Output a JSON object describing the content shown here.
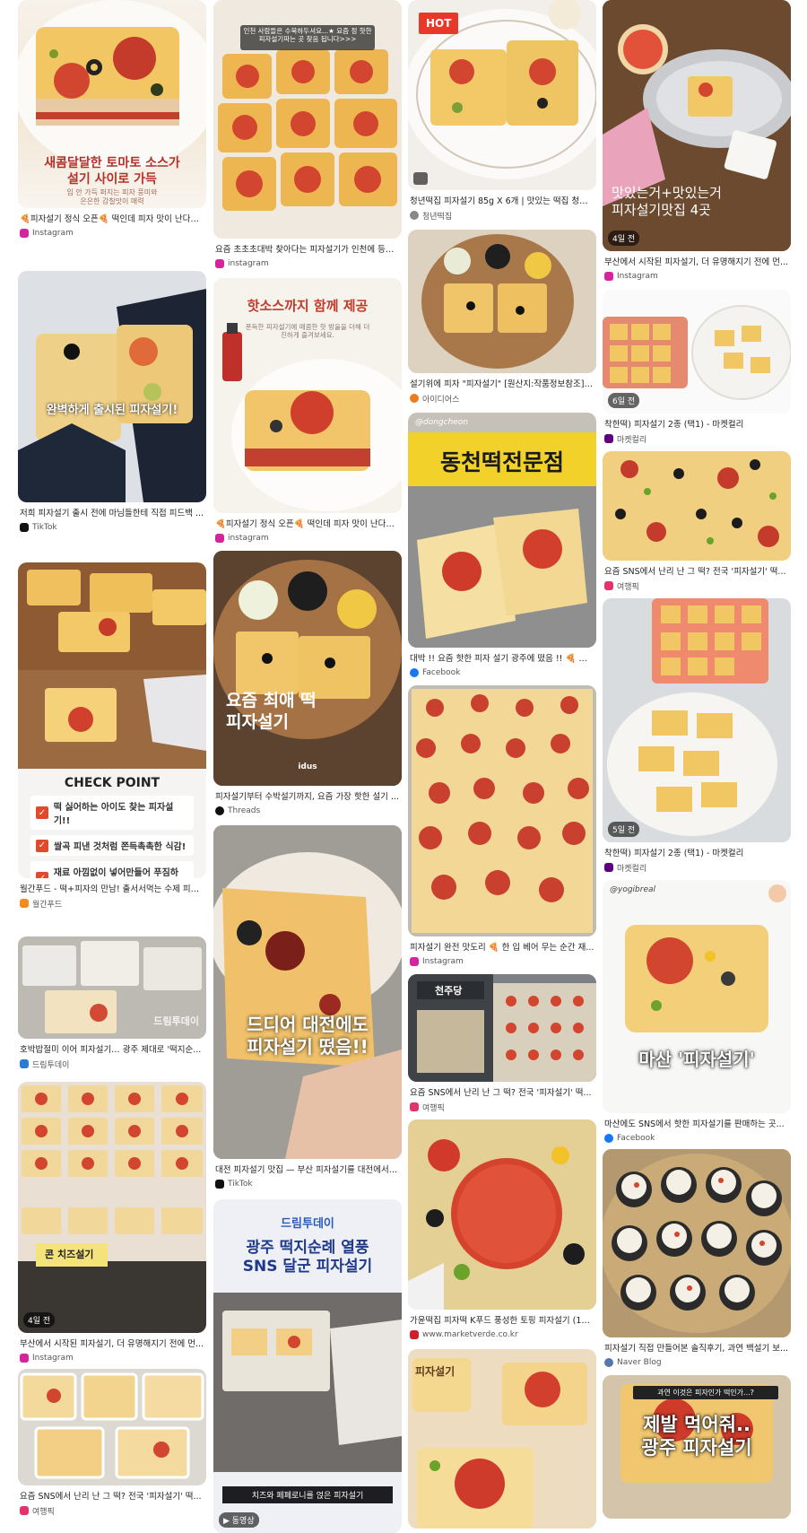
{
  "cards": [
    {
      "col": 0,
      "title": "🍕피자설기 정식 오픈🍕 떡인데 피자 맛이 난다고 ...",
      "source": "Instagram",
      "srcColor": "#d6249f"
    },
    {
      "col": 0,
      "title": "저희 피자설기 출시 전에 마님들한테 직접 피드백 ...",
      "source": "TikTok",
      "srcColor": "#111111",
      "overlay": "완벽하게 출시된 피자설기!"
    },
    {
      "col": 0,
      "title": "월간푸드 - 떡+피자의 만남! 출서서먹는 수제 피자...",
      "source": "월간푸드",
      "srcColor": "#f28c1e",
      "checkTitle": "CHECK POINT",
      "checks": [
        "떡 싫어하는 아이도 찾는 피자설기!!",
        "쌀곡 피낸 것처럼 쫀득촉촉한 식감!",
        "재료 아낌없이 넣어만들어 푸짐하게!"
      ]
    },
    {
      "col": 0,
      "title": "호박밥절미 이어 피자설기… 광주 제대로 '떡지순...",
      "source": "드림투데이",
      "srcColor": "#2a7bd6",
      "overlay": "드림투데이"
    },
    {
      "col": 0,
      "title": "부산에서 시작된 피자설기, 더 유명해지기 전에 먼...",
      "source": "Instagram",
      "srcColor": "#d6249f",
      "badge": "4일 전",
      "overlay": "콘 치즈설기"
    },
    {
      "col": 0,
      "title": "요즘 SNS에서 난리 난 그 떡? 전국 '피자설기' 떡...",
      "source": "여행픽",
      "srcColor": "#e2336b"
    },
    {
      "col": 1,
      "title": "요즘 초초초대박 찾아다는 피자설기가 인천에 등장...",
      "source": "instagram",
      "srcColor": "#d6249f",
      "topText": "인천 사람들은 수북하두셔요...★ 요즘 정 핫한 피자설기파는 곳 찾음 됩니다>>>"
    },
    {
      "col": 1,
      "title": "🍕피자설기 정식 오픈🍕 떡인데 피자 맛이 난다고...",
      "source": "instagram",
      "srcColor": "#d6249f",
      "head": "핫소스까지 함께 제공",
      "sub": "푼득한 피자설기에 매콤한 핫 방울을 더해 더 진하게 즐겨보세요."
    },
    {
      "col": 1,
      "title": "피자설기부터 수박설기까지, 요즘 가장 핫한 설기 ...",
      "source": "Threads",
      "srcColor": "#111111",
      "overlay": "요즘 최애 떡\n피자설기",
      "brand": "idus"
    },
    {
      "col": 1,
      "title": "대전 피자설기 맛집 — 부산 피자설기를 대전에서?...",
      "source": "TikTok",
      "srcColor": "#111111",
      "overlay": "드디어 대전에도\n피자설기 떴음!!"
    },
    {
      "col": 1,
      "title": "",
      "source": "",
      "srcColor": "#ffffff",
      "brand": "드림투데이",
      "head": "광주 떡지순례 열풍\nSNS 달군 피자설기",
      "caption": "치즈와 페페로니를 얹은 피자설기",
      "badge": "▶ 동영상"
    },
    {
      "col": 2,
      "title": "청년떡집 피자설기 85g X 6개 | 맛있는 떡집 청년 ...",
      "source": "청년떡집",
      "srcColor": "#888888",
      "hot": "HOT"
    },
    {
      "col": 2,
      "title": "설기위에 피자 \"피자설기\" [원산지:작품정보참조] ...",
      "source": "아이디어스",
      "srcColor": "#f07a1a"
    },
    {
      "col": 2,
      "title": "대박 !! 요즘 핫한 피자 설기 광주에 떴음 !! 🍕 알...",
      "source": "Facebook",
      "srcColor": "#1877f2",
      "sign": "동천떡전문점",
      "tag": "@dongcheon"
    },
    {
      "col": 2,
      "title": "피자설기 완전 맛도리 🍕 한 입 베어 무는 순간 재...",
      "source": "Instagram",
      "srcColor": "#d6249f"
    },
    {
      "col": 2,
      "title": "요즘 SNS에서 난리 난 그 떡? 전국 '피자설기' 떡...",
      "source": "여행픽",
      "srcColor": "#e2336b",
      "sign": "천주당"
    },
    {
      "col": 2,
      "title": "가윤떡집 피자떡 K푸드 풍성한 토핑 피자설기 (12...",
      "source": "www.marketverde.co.kr",
      "srcColor": "#d01f2a"
    },
    {
      "col": 2,
      "title": "",
      "source": "",
      "srcColor": "#ffffff",
      "sign": "피자설기"
    },
    {
      "col": 3,
      "title": "부산에서 시작된 피자설기, 더 유명해지기 전에 먼...",
      "source": "Instagram",
      "srcColor": "#d6249f",
      "badge": "4일 전",
      "overlay": "맛있는거+맛있는거\n피자설기맛집 4곳"
    },
    {
      "col": 3,
      "title": "착한떡) 피자설기 2종 (택1) - 마켓컬리",
      "source": "마켓컬리",
      "srcColor": "#5f0080",
      "badge": "6일 전"
    },
    {
      "col": 3,
      "title": "요즘 SNS에서 난리 난 그 떡? 전국 '피자설기' 떡...",
      "source": "여행픽",
      "srcColor": "#e2336b"
    },
    {
      "col": 3,
      "title": "착한떡) 피자설기 2종 (택1) - 마켓컬리",
      "source": "마켓컬리",
      "srcColor": "#5f0080",
      "badge": "5일 전"
    },
    {
      "col": 3,
      "title": "마산에도 SNS에서 핫한 피자설기를 판매하는 곳...",
      "source": "Facebook",
      "srcColor": "#1877f2",
      "overlay": "마산 '피자설기'",
      "tag": "@yogibreal"
    },
    {
      "col": 3,
      "title": "피자설기 직접 만들어본 솔직후기, 과연 백설기 보...",
      "source": "Naver Blog",
      "srcColor": "#5577aa"
    },
    {
      "col": 3,
      "title": "",
      "source": "",
      "srcColor": "#ffffff",
      "overlay": "제발 먹어줘..\n광주 피자설기",
      "sub": "과연 이것은 피자인가 떡인가...?"
    }
  ]
}
